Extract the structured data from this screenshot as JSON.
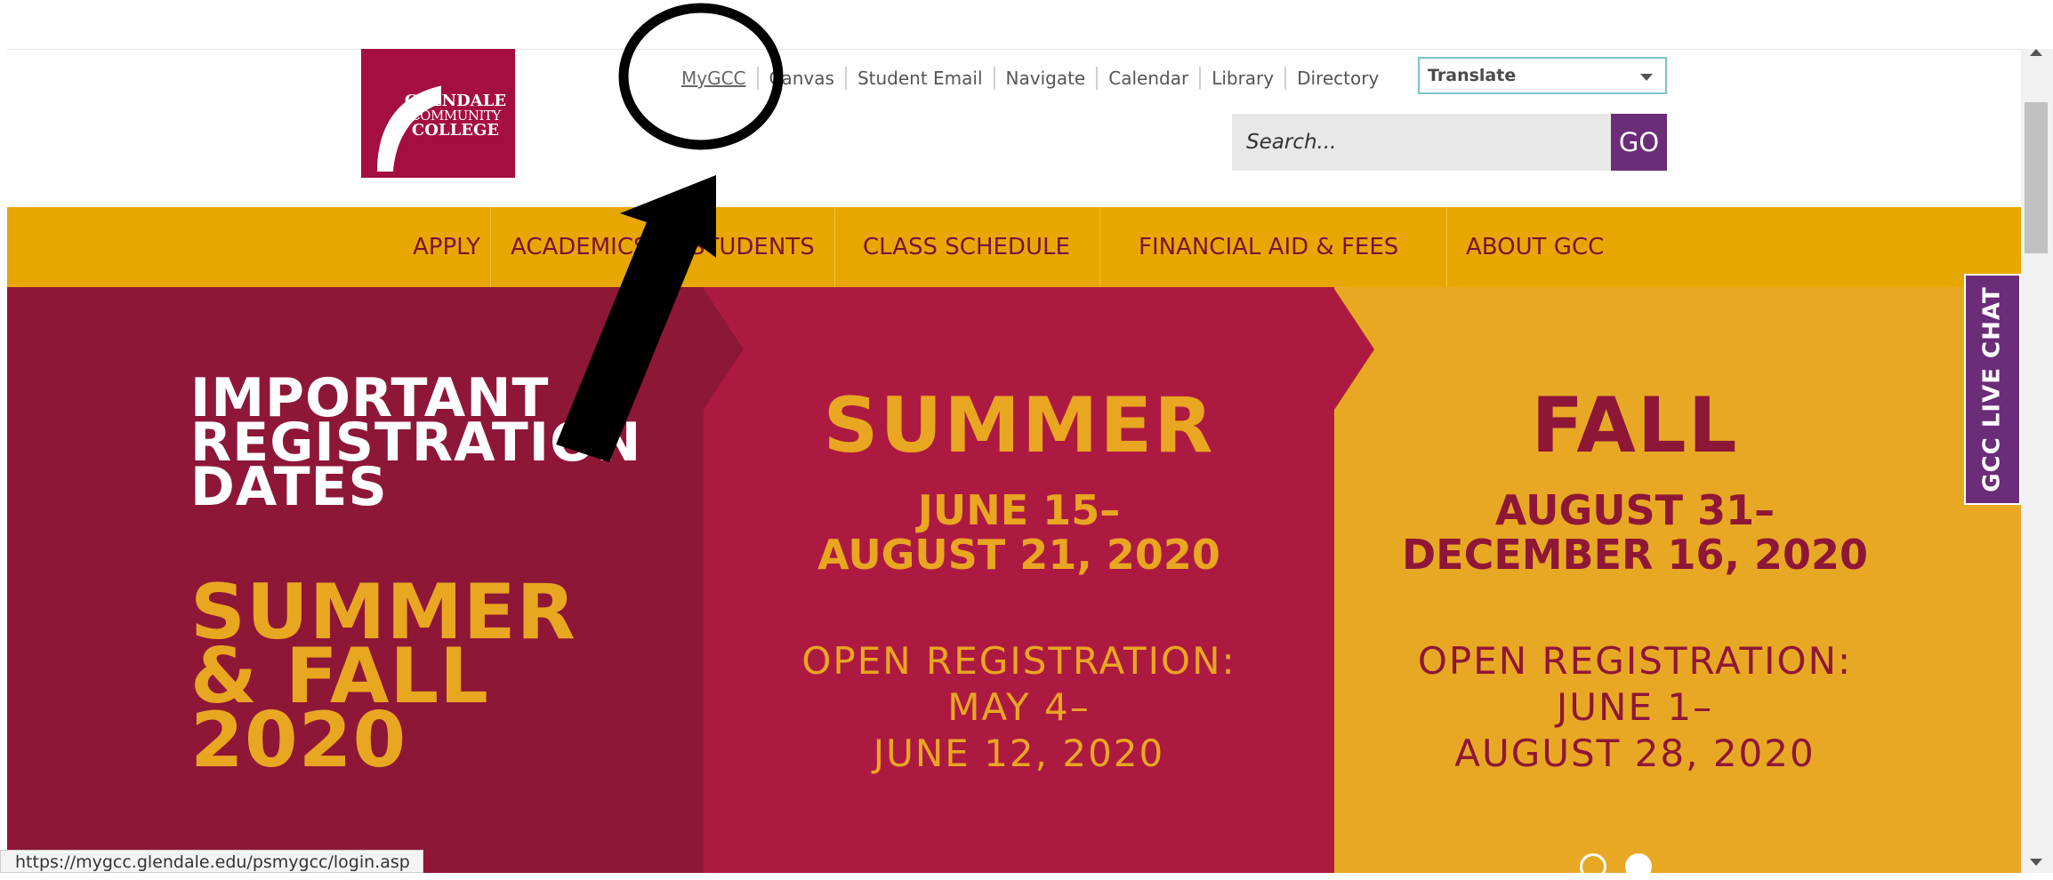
{
  "logo": {
    "line1": "GLENDALE",
    "line2": "COMMUNITY",
    "line3": "COLLEGE"
  },
  "utility_links": [
    "MyGCC",
    "Canvas",
    "Student Email",
    "Navigate",
    "Calendar",
    "Library",
    "Directory"
  ],
  "translate": {
    "label": "Translate"
  },
  "search": {
    "placeholder": "Search...",
    "button": "GO"
  },
  "main_nav": [
    "APPLY",
    "ACADEMICS",
    "STUDENTS",
    "CLASS SCHEDULE",
    "FINANCIAL AID & FEES",
    "ABOUT GCC"
  ],
  "hero": {
    "panel1": {
      "line1": "IMPORTANT",
      "line2": "REGISTRATION",
      "line3": "DATES",
      "line4": "SUMMER",
      "line5": "& FALL",
      "line6": "2020"
    },
    "panel2": {
      "title": "SUMMER",
      "date1": "JUNE 15–",
      "date2": "AUGUST 21, 2020",
      "open1": "OPEN REGISTRATION:",
      "open2": "MAY 4–",
      "open3": "JUNE 12, 2020"
    },
    "panel3": {
      "title": "FALL",
      "date1": "AUGUST 31–",
      "date2": "DECEMBER 16, 2020",
      "open1": "OPEN REGISTRATION:",
      "open2": "JUNE 1–",
      "open3": "AUGUST 28, 2020"
    }
  },
  "live_chat": {
    "label": "GCC LIVE CHAT"
  },
  "status_bar": {
    "url": "https://mygcc.glendale.edu/psmygcc/login.asp"
  },
  "colors": {
    "maroon": "#8e1737",
    "crimson": "#ad1a41",
    "gold": "#e8a824",
    "nav_gold": "#e8a700",
    "purple": "#6b2c78"
  }
}
